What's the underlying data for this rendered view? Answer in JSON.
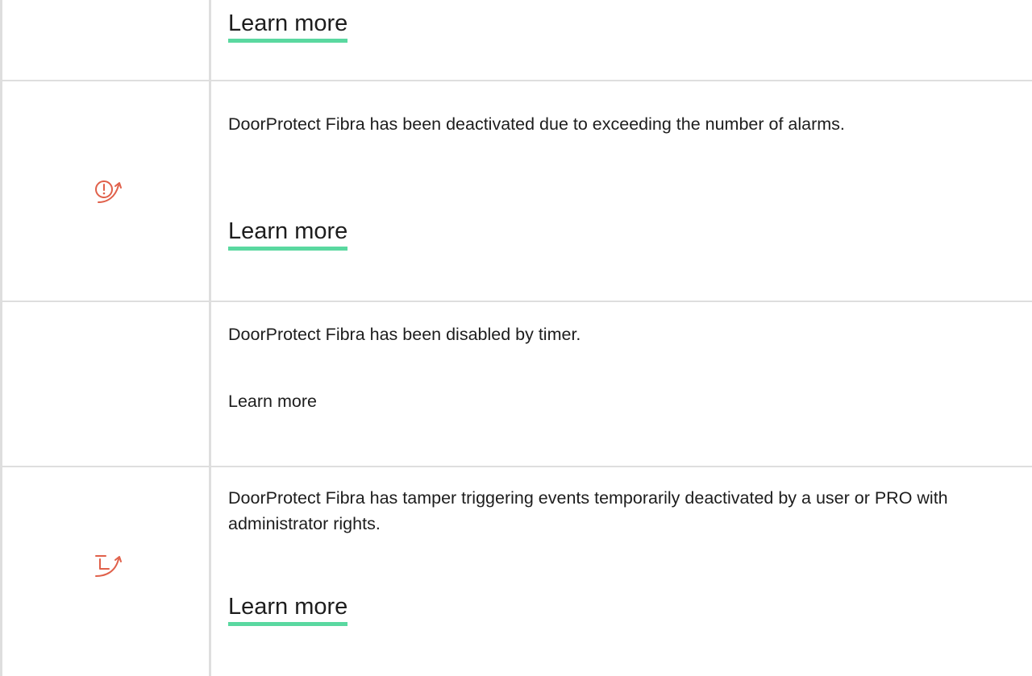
{
  "rows": [
    {
      "icon": null,
      "description": "",
      "link_label": "Learn more",
      "link_style": "underlined"
    },
    {
      "icon": "alarm-deactivated-icon",
      "description": "DoorProtect Fibra has been deactivated due to exceeding the number of alarms.",
      "link_label": "Learn more",
      "link_style": "underlined"
    },
    {
      "icon": null,
      "description": "DoorProtect Fibra has been disabled by timer.",
      "link_label": "Learn more",
      "link_style": "plain"
    },
    {
      "icon": "tamper-deactivated-icon",
      "description": "DoorProtect Fibra has tamper triggering events temporarily deactivated by a user or PRO with administrator rights.",
      "link_label": "Learn more",
      "link_style": "underlined"
    }
  ],
  "colors": {
    "icon": "#e0604a",
    "link_underline": "#5ad8a0",
    "border": "#dedede",
    "text": "#1d1d1d"
  }
}
